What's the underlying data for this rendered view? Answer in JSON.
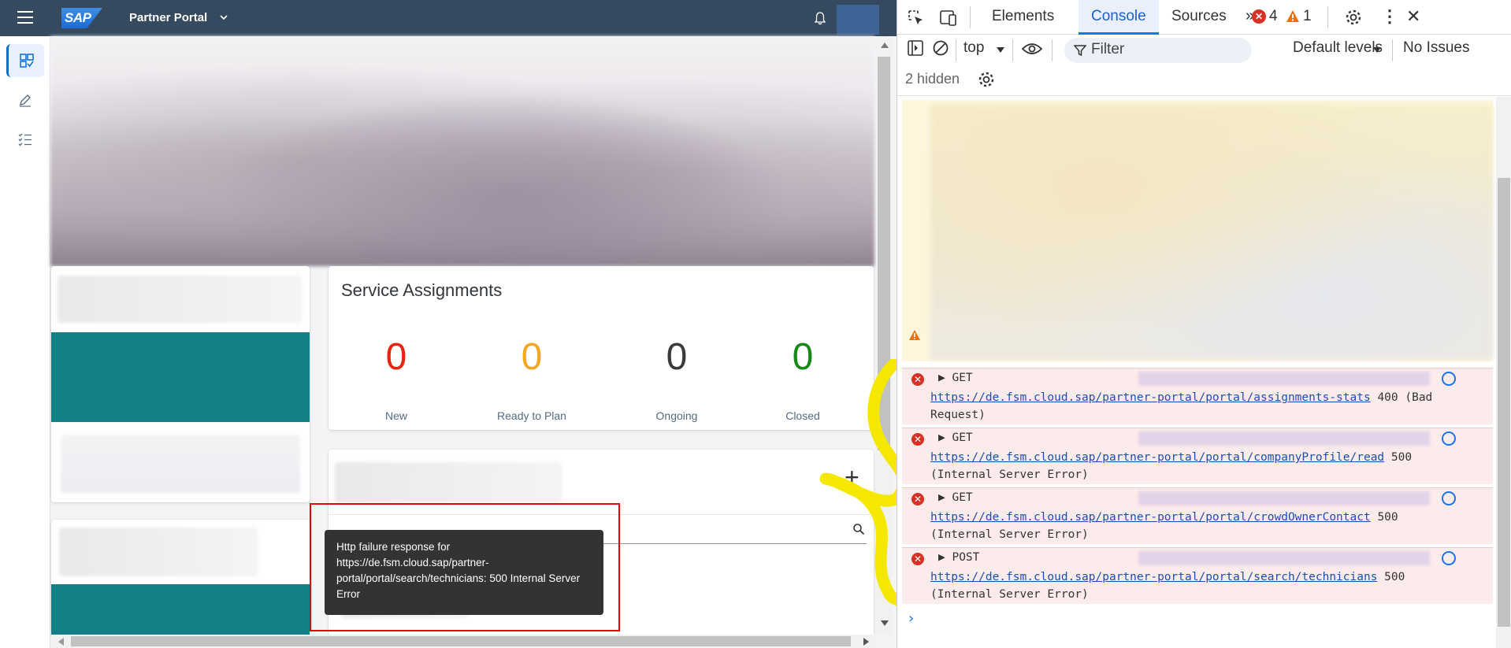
{
  "app": {
    "title": "Partner Portal",
    "brand": "SAP",
    "service_assignments": {
      "title": "Service Assignments",
      "stats": [
        {
          "value": "0",
          "label": "New",
          "color": "#e9230c"
        },
        {
          "value": "0",
          "label": "Ready to Plan",
          "color": "#f5a623"
        },
        {
          "value": "0",
          "label": "Ongoing",
          "color": "#3b3b3b"
        },
        {
          "value": "0",
          "label": "Closed",
          "color": "#188918"
        }
      ]
    },
    "tooltip": "Http failure response for https://de.fsm.cloud.sap/partner-portal/portal/search/technicians: 500 Internal Server Error"
  },
  "devtools": {
    "tabs": [
      "Elements",
      "Console",
      "Sources"
    ],
    "active_tab": "Console",
    "error_count": "4",
    "warning_count": "1",
    "context": "top",
    "filter_placeholder": "Filter",
    "levels": "Default levels",
    "issues": "No Issues",
    "hidden": "2 hidden",
    "errors": [
      {
        "method": "GET",
        "url": "https://de.fsm.cloud.sap/partner-portal/portal/assignments-stats",
        "status": "400 (Bad",
        "status_cont": "Request)"
      },
      {
        "method": "GET",
        "url": "https://de.fsm.cloud.sap/partner-portal/portal/companyProfile/read",
        "status": "500",
        "status_cont": "(Internal Server Error)"
      },
      {
        "method": "GET",
        "url": "https://de.fsm.cloud.sap/partner-portal/portal/crowdOwnerContact",
        "status": "500",
        "status_cont": "(Internal Server Error)"
      },
      {
        "method": "POST",
        "url": "https://de.fsm.cloud.sap/partner-portal/portal/search/technicians",
        "status": "500",
        "status_cont": "(Internal Server Error)"
      }
    ]
  }
}
